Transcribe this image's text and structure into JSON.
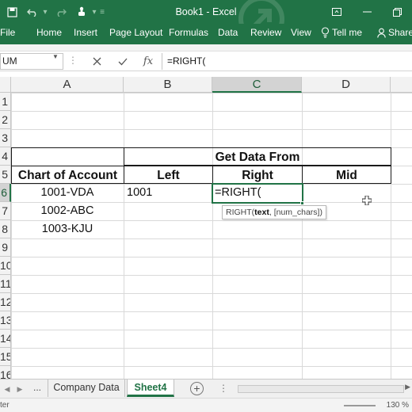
{
  "window": {
    "title": "Book1 - Excel"
  },
  "ribbon": {
    "tabs": [
      {
        "key": "file",
        "label": "File"
      },
      {
        "key": "home",
        "label": "Home"
      },
      {
        "key": "insert",
        "label": "Insert"
      },
      {
        "key": "pagelayout",
        "label": "Page Layout"
      },
      {
        "key": "formulas",
        "label": "Formulas"
      },
      {
        "key": "data",
        "label": "Data"
      },
      {
        "key": "review",
        "label": "Review"
      },
      {
        "key": "view",
        "label": "View"
      }
    ],
    "tell_me": "Tell me",
    "share": "Share"
  },
  "formula_bar": {
    "name_box": "UM",
    "fx_label": "fx",
    "content": "=RIGHT("
  },
  "sheet": {
    "columns": [
      "A",
      "B",
      "C",
      "D"
    ],
    "rows": [
      "1",
      "2",
      "3",
      "4",
      "5",
      "6",
      "7",
      "8",
      "9",
      "10",
      "11",
      "12",
      "13",
      "14",
      "15",
      "16"
    ],
    "active_column": "C",
    "active_row": "6",
    "cells": {
      "header_group": "Get Data From",
      "chart_of_account": "Chart of Account",
      "left": "Left",
      "right": "Right",
      "mid": "Mid",
      "a6": "1001-VDA",
      "a7": "1002-ABC",
      "a8": "1003-KJU",
      "b6": "1001",
      "c6": "=RIGHT("
    },
    "tooltip": {
      "func": "RIGHT(",
      "arg1": "text",
      "rest": ", [num_chars])"
    }
  },
  "sheet_tabs": {
    "ellipsis": "...",
    "tabs": [
      "Company Data",
      "Sheet4"
    ],
    "active": "Sheet4"
  },
  "status_bar": {
    "mode": "ter",
    "zoom": "130 %"
  },
  "colors": {
    "accent": "#217346",
    "gridline": "#d9d9d9"
  }
}
